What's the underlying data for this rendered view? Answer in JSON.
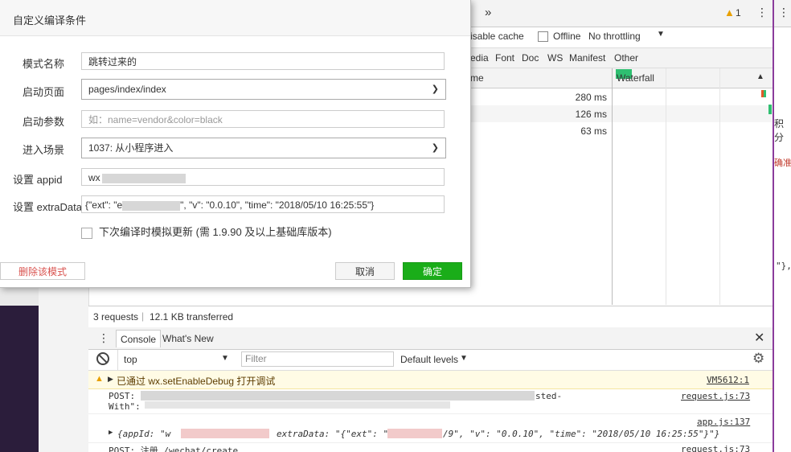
{
  "dialog": {
    "title": "自定义编译条件",
    "fields": {
      "mode_name": {
        "label": "模式名称",
        "value": "跳转过来的"
      },
      "start_page": {
        "label": "启动页面",
        "value": "pages/index/index"
      },
      "start_params": {
        "label": "启动参数",
        "placeholder": "如：name=vendor&color=black"
      },
      "scene": {
        "label": "进入场景",
        "value": "1037: 从小程序进入"
      },
      "appid": {
        "label": "设置 appid",
        "value_prefix": "wx"
      },
      "extra_data": {
        "label": "设置 extraData",
        "value_prefix": "{\"ext\": \"e",
        "value_suffix": "\", \"v\": \"0.0.10\", \"time\": \"2018/05/10 16:25:55\"}"
      }
    },
    "checkbox_label": "下次编译时模拟更新 (需 1.9.90 及以上基础库版本)",
    "delete_label": "删除该模式",
    "cancel_label": "取消",
    "confirm_label": "确定"
  },
  "network": {
    "more_tabs": "»",
    "warn_count": "1",
    "disable_cache": "isable cache",
    "offline": "Offline",
    "throttling": "No throttling",
    "filters": [
      "edia",
      "Font",
      "Doc",
      "WS",
      "Manifest",
      "Other"
    ],
    "col_time": "me",
    "col_waterfall": "Waterfall",
    "times": [
      "280 ms",
      "126 ms",
      "63 ms"
    ],
    "summary": "3 requests",
    "transferred": "12.1 KB transferred"
  },
  "console": {
    "tabs": [
      "Console",
      "What's New"
    ],
    "context": "top",
    "filter_placeholder": "Filter",
    "levels": "Default levels",
    "rows": [
      {
        "text": "已通过 wx.setEnableDebug 打开调试",
        "source": "VM5612:1"
      },
      {
        "text": "POST: ",
        "text2": "sted-",
        "text3": "With\":",
        "source": "request.js:73"
      },
      {
        "source": "app.js:137",
        "text": "{appId: \"w",
        "text_mid": "extraData: \"{\"ext\": \"",
        "text_end": "/9\", \"v\": \"0.0.10\", \"time\": \"2018/05/10 16:25:55\"}\"}"
      },
      {
        "text": "POST: 注册 /wechat/create",
        "source": "request.js:73"
      }
    ]
  },
  "right_edge": {
    "texts": [
      "积分",
      "确准",
      "\"},"
    ]
  }
}
